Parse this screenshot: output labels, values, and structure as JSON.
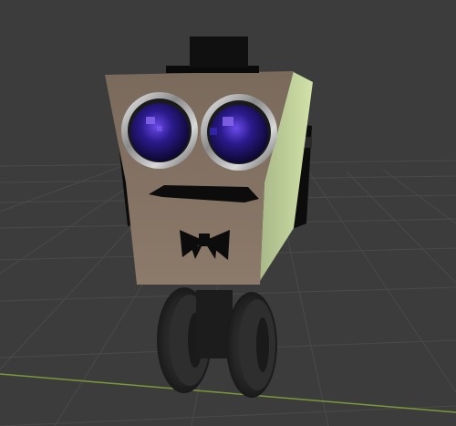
{
  "viewport": {
    "background": "#3c3c3c",
    "grid_color": "#4a4a4a",
    "x_axis_color": "#7a9a3a"
  },
  "robot": {
    "body_color": "#8a7767",
    "body_side_color": "#c8d8a0",
    "eye_iris_color": "#2a1a8a",
    "eye_highlight_color": "#6a4ae8",
    "rim_color": "#c8c8c8",
    "hat_color": "#101010",
    "mustache_color": "#0c0c0c",
    "bowtie_color": "#0c0c0c",
    "wheel_color": "#2a2a2a",
    "ear_color": "#0c0c0c",
    "icons": [
      "robot-head",
      "top-hat",
      "left-eye",
      "right-eye",
      "mustache",
      "bow-tie",
      "left-wheel",
      "right-wheel"
    ]
  }
}
